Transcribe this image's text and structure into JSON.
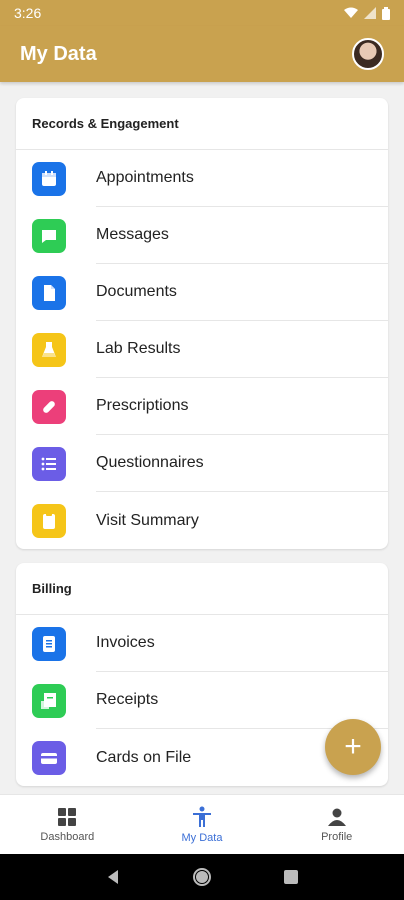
{
  "status": {
    "time": "3:26"
  },
  "appbar": {
    "title": "My Data"
  },
  "sections": [
    {
      "header": "Records & Engagement",
      "items": [
        {
          "label": "Appointments",
          "icon": "calendar-icon",
          "color": "#1a73e8"
        },
        {
          "label": "Messages",
          "icon": "chat-icon",
          "color": "#2ecc55"
        },
        {
          "label": "Documents",
          "icon": "document-icon",
          "color": "#1a73e8"
        },
        {
          "label": "Lab Results",
          "icon": "flask-icon",
          "color": "#f5c518"
        },
        {
          "label": "Prescriptions",
          "icon": "pill-icon",
          "color": "#ec3f7a"
        },
        {
          "label": "Questionnaires",
          "icon": "list-icon",
          "color": "#6b5de6"
        },
        {
          "label": "Visit Summary",
          "icon": "clipboard-icon",
          "color": "#f5c518"
        }
      ]
    },
    {
      "header": "Billing",
      "items": [
        {
          "label": "Invoices",
          "icon": "invoice-icon",
          "color": "#1a73e8"
        },
        {
          "label": "Receipts",
          "icon": "receipt-icon",
          "color": "#2ecc55"
        },
        {
          "label": "Cards on File",
          "icon": "credit-card-icon",
          "color": "#6b5de6"
        }
      ]
    }
  ],
  "fab": {
    "label": "+"
  },
  "bottomnav": {
    "dashboard": "Dashboard",
    "mydata": "My Data",
    "profile": "Profile"
  }
}
